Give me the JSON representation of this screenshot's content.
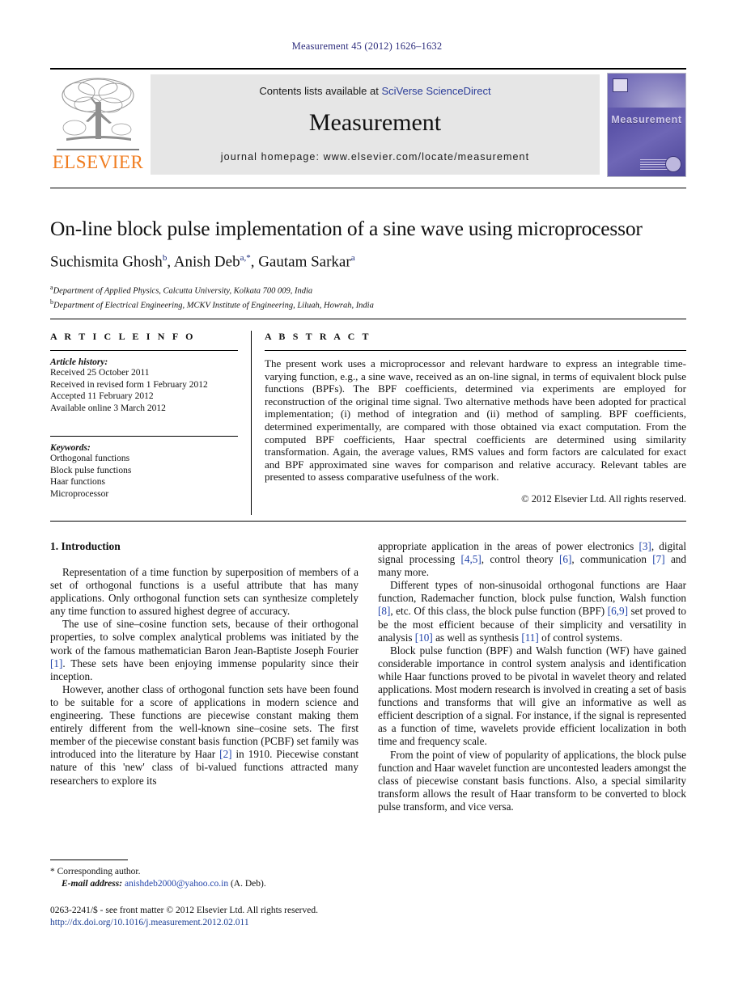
{
  "running_head": "Measurement 45 (2012) 1626–1632",
  "masthead": {
    "contents_prefix": "Contents lists available at ",
    "sciencedirect": "SciVerse ScienceDirect",
    "journal_name": "Measurement",
    "homepage": "journal homepage: www.elsevier.com/locate/measurement",
    "publisher_wordmark": "ELSEVIER",
    "cover_title": "Measurement",
    "accent_link_color": "#2b3d99",
    "elsevier_orange": "#f07d20"
  },
  "article": {
    "title": "On-line block pulse implementation of a sine wave using microprocessor",
    "authors_html": "Suchismita Ghosh<sup>b</sup>, Anish Deb<sup>a,*</sup>, Gautam Sarkar<sup>a</sup>",
    "affiliations": [
      {
        "marker": "a",
        "text": "Department of Applied Physics, Calcutta University, Kolkata 700 009, India"
      },
      {
        "marker": "b",
        "text": "Department of Electrical Engineering, MCKV Institute of Engineering, Liluah, Howrah, India"
      }
    ]
  },
  "article_info": {
    "heading": "A R T I C L E  I N F O",
    "history_label": "Article history:",
    "history": [
      "Received 25 October 2011",
      "Received in revised form 1 February 2012",
      "Accepted 11 February 2012",
      "Available online 3 March 2012"
    ],
    "keywords_label": "Keywords:",
    "keywords": [
      "Orthogonal functions",
      "Block pulse functions",
      "Haar functions",
      "Microprocessor"
    ]
  },
  "abstract": {
    "heading": "A B S T R A C T",
    "text": "The present work uses a microprocessor and relevant hardware to express an integrable time-varying function, e.g., a sine wave, received as an on-line signal, in terms of equivalent block pulse functions (BPFs). The BPF coefficients, determined via experiments are employed for reconstruction of the original time signal. Two alternative methods have been adopted for practical implementation; (i) method of integration and (ii) method of sampling. BPF coefficients, determined experimentally, are compared with those obtained via exact computation. From the computed BPF coefficients, Haar spectral coefficients are determined using similarity transformation. Again, the average values, RMS values and form factors are calculated for exact and BPF approximated sine waves for comparison and relative accuracy. Relevant tables are presented to assess comparative usefulness of the work.",
    "copyright": "© 2012 Elsevier Ltd. All rights reserved."
  },
  "body": {
    "section_heading": "1. Introduction",
    "left_paragraphs": [
      "Representation of a time function by superposition of members of a set of orthogonal functions is a useful attribute that has many applications. Only orthogonal function sets can synthesize completely any time function to assured highest degree of accuracy.",
      "The use of sine–cosine function sets, because of their orthogonal properties, to solve complex analytical problems was initiated by the work of the famous mathematician Baron Jean-Baptiste Joseph Fourier [1]. These sets have been enjoying immense popularity since their inception.",
      "However, another class of orthogonal function sets have been found to be suitable for a score of applications in modern science and engineering. These functions are piecewise constant making them entirely different from the well-known sine–cosine sets. The first member of the piecewise constant basis function (PCBF) set family was introduced into the literature by Haar [2] in 1910. Piecewise constant nature of this 'new' class of bi-valued functions attracted many researchers to explore its"
    ],
    "right_paragraphs": [
      "appropriate application in the areas of power electronics [3], digital signal processing [4,5], control theory [6], communication [7] and many more.",
      "Different types of non-sinusoidal orthogonal functions are Haar function, Rademacher function, block pulse function, Walsh function [8], etc. Of this class, the block pulse function (BPF) [6,9] set proved to be the most efficient because of their simplicity and versatility in analysis [10] as well as synthesis [11] of control systems.",
      "Block pulse function (BPF) and Walsh function (WF) have gained considerable importance in control system analysis and identification while Haar functions proved to be pivotal in wavelet theory and related applications. Most modern research is involved in creating a set of basis functions and transforms that will give an informative as well as efficient description of a signal. For instance, if the signal is represented as a function of time, wavelets provide efficient localization in both time and frequency scale.",
      "From the point of view of popularity of applications, the block pulse function and Haar wavelet function are uncontested leaders amongst the class of piecewise constant basis functions. Also, a special similarity transform allows the result of Haar transform to be converted to block pulse transform, and vice versa."
    ]
  },
  "footnotes": {
    "corresponding_marker": "*",
    "corresponding_text": "Corresponding author.",
    "email_label": "E-mail address:",
    "email": "anishdeb2000@yahoo.co.in",
    "email_owner": "(A. Deb).",
    "imprint": "0263-2241/$ - see front matter © 2012 Elsevier Ltd. All rights reserved.",
    "doi": "http://dx.doi.org/10.1016/j.measurement.2012.02.011"
  }
}
